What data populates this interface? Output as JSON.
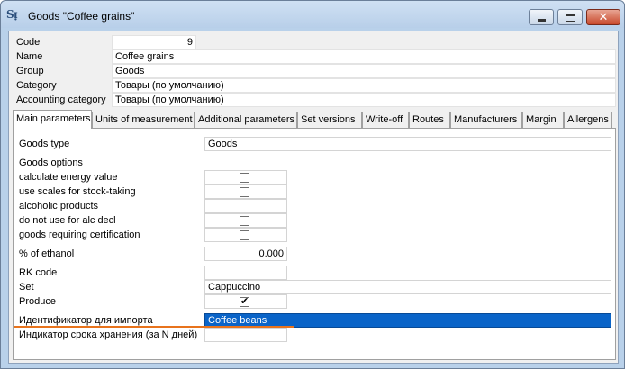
{
  "window": {
    "title": "Goods \"Coffee grains\"",
    "app_icon_text": "Sᴉ",
    "close_glyph": "✕"
  },
  "header": {
    "code_label": "Code",
    "code_value": "9",
    "name_label": "Name",
    "name_value": "Coffee grains",
    "group_label": "Group",
    "group_value": "Goods",
    "category_label": "Category",
    "category_value": "Товары (по умолчанию)",
    "accounting_label": "Accounting category",
    "accounting_value": "Товары (по умолчанию)"
  },
  "tabs": [
    {
      "label": "Main parameters",
      "active": true
    },
    {
      "label": "Units of measurement"
    },
    {
      "label": "Additional parameters"
    },
    {
      "label": "Set versions"
    },
    {
      "label": "Write-off"
    },
    {
      "label": "Routes"
    },
    {
      "label": "Manufacturers"
    },
    {
      "label": "Margin"
    },
    {
      "label": "Allergens"
    }
  ],
  "main": {
    "goods_type_label": "Goods type",
    "goods_type_value": "Goods",
    "goods_options_label": "Goods options",
    "options": [
      {
        "label": "calculate energy value",
        "checked": false
      },
      {
        "label": "use scales for stock-taking",
        "checked": false
      },
      {
        "label": "alcoholic products",
        "checked": false
      },
      {
        "label": "do not use for alc decl",
        "checked": false
      },
      {
        "label": "goods requiring certification",
        "checked": false
      }
    ],
    "ethanol_label": "% of ethanol",
    "ethanol_value": "0.000",
    "rk_code_label": "RK code",
    "rk_code_value": "",
    "set_label": "Set",
    "set_value": "Cappuccino",
    "produce_label": "Produce",
    "produce_checked": true,
    "import_id_label": "Идентификатор для импорта",
    "import_id_value": "Coffee beans",
    "shelf_life_label": "Индикатор срока хранения (за N дней)",
    "shelf_life_value": "",
    "check_glyph": "✔"
  },
  "colors": {
    "selection": "#0a64c8",
    "underline_accent": "#e8731c",
    "title_bar": "#b9d1ea"
  }
}
